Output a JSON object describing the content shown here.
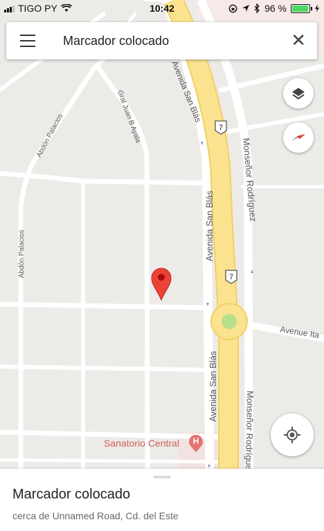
{
  "status_bar": {
    "carrier": "TIGO PY",
    "time": "10:42",
    "battery_percent": "96 %",
    "battery_level": 0.96
  },
  "search": {
    "title": "Marcador colocado",
    "menu_icon": "hamburger-menu-icon",
    "close_icon": "close-icon"
  },
  "map": {
    "streets": [
      "Avenida San Blás",
      "Avenida San Blás",
      "Avenida San Blás",
      "Monseñor Rodríguez",
      "Monseñor Rodríguez",
      "Abdón Palacios",
      "Abdón Palacios",
      "Gral Juan B Ayala",
      "Avenue Ita"
    ],
    "route_shields": [
      "7",
      "7"
    ],
    "poi": {
      "name": "Sanatorio Central",
      "icon": "hospital-icon"
    },
    "colors": {
      "highway": "#fbe28f",
      "highway_edge": "#f3cf63",
      "marker": "#ea4335",
      "poi_text": "#d25e5e"
    }
  },
  "controls": {
    "layers_icon": "layers-icon",
    "compass_icon": "compass-icon",
    "my_location_icon": "my-location-icon"
  },
  "place_sheet": {
    "name": "Marcador colocado",
    "address": "cerca de Unnamed Road, Cd. del Este"
  }
}
